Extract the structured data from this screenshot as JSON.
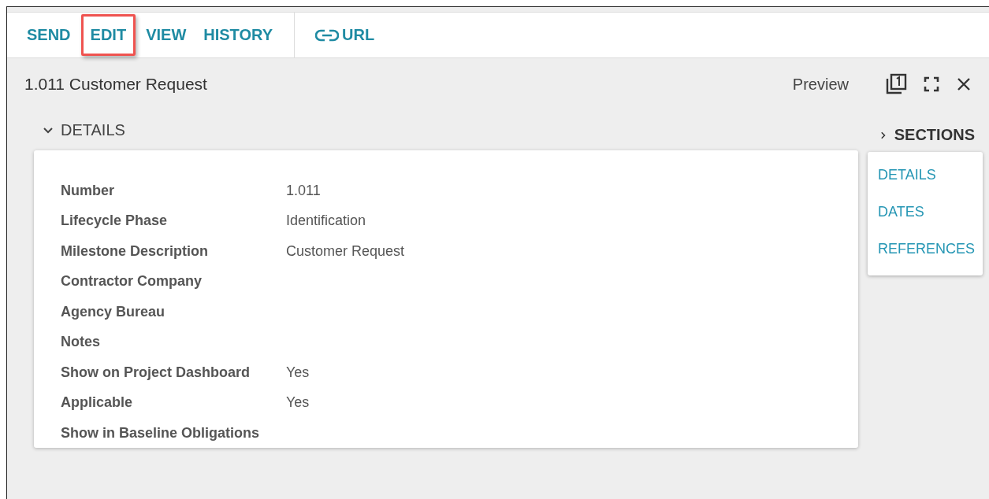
{
  "toolbar": {
    "actions": [
      {
        "label": "SEND",
        "highlighted": false
      },
      {
        "label": "EDIT",
        "highlighted": true
      },
      {
        "label": "VIEW",
        "highlighted": false
      },
      {
        "label": "HISTORY",
        "highlighted": false
      }
    ],
    "link": {
      "label": "URL"
    }
  },
  "header": {
    "title": "1.011 Customer Request",
    "preview": "Preview"
  },
  "section": {
    "title": "DETAILS",
    "expanded": true,
    "fields": [
      {
        "label": "Number",
        "value": "1.011"
      },
      {
        "label": "Lifecycle Phase",
        "value": "Identification"
      },
      {
        "label": "Milestone Description",
        "value": "Customer Request"
      },
      {
        "label": "Contractor Company"
      },
      {
        "label": "Agency Bureau"
      },
      {
        "label": "Notes"
      },
      {
        "label": "Show on Project Dashboard",
        "value": "Yes"
      },
      {
        "label": "Applicable",
        "value": "Yes"
      },
      {
        "label": "Show in Baseline Obligations"
      }
    ]
  },
  "sections_nav": {
    "title": "SECTIONS",
    "expanded": false,
    "items": [
      "DETAILS",
      "DATES",
      "REFERENCES"
    ]
  }
}
